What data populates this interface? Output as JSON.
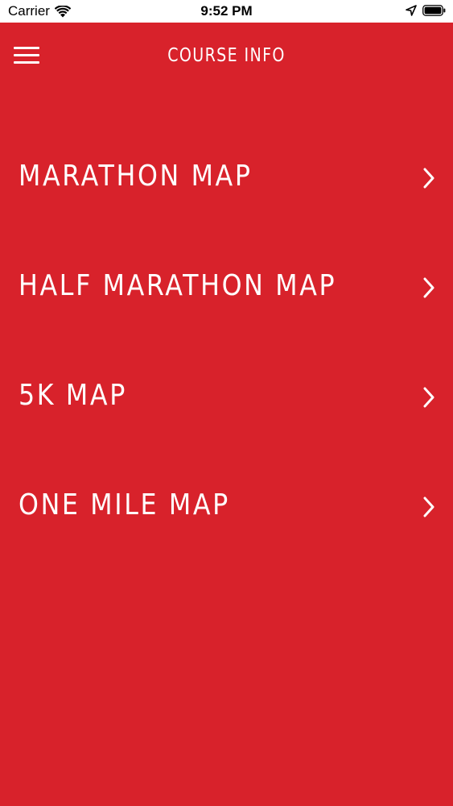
{
  "status_bar": {
    "carrier": "Carrier",
    "time": "9:52 PM",
    "icons": [
      "wifi-icon",
      "location-arrow-icon",
      "battery-icon"
    ]
  },
  "header": {
    "title": "COURSE INFO",
    "menu_icon": "hamburger-menu-icon"
  },
  "menu": {
    "items": [
      {
        "label": "MARATHON MAP",
        "icon": "chevron-right-icon"
      },
      {
        "label": "HALF MARATHON MAP",
        "icon": "chevron-right-icon"
      },
      {
        "label": "5K MAP",
        "icon": "chevron-right-icon"
      },
      {
        "label": "ONE MILE MAP",
        "icon": "chevron-right-icon"
      }
    ]
  },
  "colors": {
    "background": "#d8222b",
    "text": "#ffffff",
    "status_bar": "#ffffff"
  }
}
